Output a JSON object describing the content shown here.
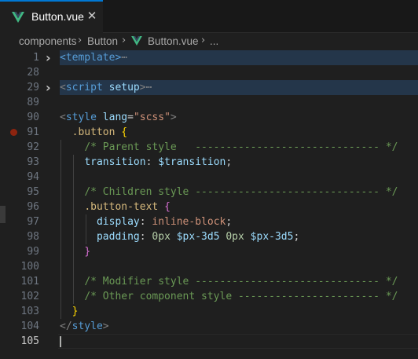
{
  "tab": {
    "title": "Button.vue",
    "close_glyph": "✕"
  },
  "breadcrumb": {
    "parts": [
      "components",
      "Button",
      "Button.vue",
      "..."
    ]
  },
  "colors": {
    "accent": "#0078d4",
    "vue_green": "#41b883",
    "vue_dark": "#35495e",
    "breakpoint": "#a1260d"
  },
  "lines": [
    {
      "n": "1",
      "tokens": [
        [
          "t-tag",
          "<template>"
        ],
        [
          "t-ell",
          "⋯"
        ]
      ]
    },
    {
      "n": "28",
      "tokens": []
    },
    {
      "n": "29",
      "tokens": [
        [
          "t-punct",
          "<"
        ],
        [
          "t-tag",
          "script"
        ],
        [
          "t-plain",
          " "
        ],
        [
          "t-attr",
          "setup"
        ],
        [
          "t-punct",
          ">"
        ],
        [
          "t-ell",
          "⋯"
        ]
      ]
    },
    {
      "n": "89",
      "tokens": []
    },
    {
      "n": "90",
      "tokens": [
        [
          "t-punct",
          "<"
        ],
        [
          "t-tag",
          "style"
        ],
        [
          "t-plain",
          " "
        ],
        [
          "t-attr",
          "lang"
        ],
        [
          "t-plain",
          "="
        ],
        [
          "t-str",
          "\"scss\""
        ],
        [
          "t-punct",
          ">"
        ]
      ]
    },
    {
      "n": "91",
      "tokens": [
        [
          "t-plain",
          "  "
        ],
        [
          "t-sel",
          ".button"
        ],
        [
          "t-plain",
          " "
        ],
        [
          "t-brace1",
          "{"
        ]
      ]
    },
    {
      "n": "92",
      "tokens": [
        [
          "t-plain",
          "    "
        ],
        [
          "t-com",
          "/* Parent style   ------------------------------ */"
        ]
      ]
    },
    {
      "n": "93",
      "tokens": [
        [
          "t-plain",
          "    "
        ],
        [
          "t-prop",
          "transition"
        ],
        [
          "t-plain",
          ": "
        ],
        [
          "t-var",
          "$transition"
        ],
        [
          "t-plain",
          ";"
        ]
      ]
    },
    {
      "n": "94",
      "tokens": []
    },
    {
      "n": "95",
      "tokens": [
        [
          "t-plain",
          "    "
        ],
        [
          "t-com",
          "/* Children style ------------------------------ */"
        ]
      ]
    },
    {
      "n": "96",
      "tokens": [
        [
          "t-plain",
          "    "
        ],
        [
          "t-sel",
          ".button-text"
        ],
        [
          "t-plain",
          " "
        ],
        [
          "t-brace2",
          "{"
        ]
      ]
    },
    {
      "n": "97",
      "tokens": [
        [
          "t-plain",
          "      "
        ],
        [
          "t-prop",
          "display"
        ],
        [
          "t-plain",
          ": "
        ],
        [
          "t-val",
          "inline-block"
        ],
        [
          "t-plain",
          ";"
        ]
      ]
    },
    {
      "n": "98",
      "tokens": [
        [
          "t-plain",
          "      "
        ],
        [
          "t-prop",
          "padding"
        ],
        [
          "t-plain",
          ": "
        ],
        [
          "t-num",
          "0px"
        ],
        [
          "t-plain",
          " "
        ],
        [
          "t-var",
          "$px-3d5"
        ],
        [
          "t-plain",
          " "
        ],
        [
          "t-num",
          "0px"
        ],
        [
          "t-plain",
          " "
        ],
        [
          "t-var",
          "$px-3d5"
        ],
        [
          "t-plain",
          ";"
        ]
      ]
    },
    {
      "n": "99",
      "tokens": [
        [
          "t-plain",
          "    "
        ],
        [
          "t-brace2",
          "}"
        ]
      ]
    },
    {
      "n": "100",
      "tokens": []
    },
    {
      "n": "101",
      "tokens": [
        [
          "t-plain",
          "    "
        ],
        [
          "t-com",
          "/* Modifier style ------------------------------ */"
        ]
      ]
    },
    {
      "n": "102",
      "tokens": [
        [
          "t-plain",
          "    "
        ],
        [
          "t-com",
          "/* Other component style ----------------------- */"
        ]
      ]
    },
    {
      "n": "103",
      "tokens": [
        [
          "t-plain",
          "  "
        ],
        [
          "t-brace1",
          "}"
        ]
      ]
    },
    {
      "n": "104",
      "tokens": [
        [
          "t-punct",
          "</"
        ],
        [
          "t-tag",
          "style"
        ],
        [
          "t-punct",
          ">"
        ]
      ]
    },
    {
      "n": "105",
      "tokens": []
    }
  ],
  "active_line": "105",
  "breakpoint_line": "91",
  "folded_lines": [
    "1",
    "29"
  ],
  "icons": {
    "vue": "vue-logo-icon",
    "close": "close-icon",
    "chevron": "chevron-right-icon",
    "fold": "fold-chevron-icon"
  }
}
